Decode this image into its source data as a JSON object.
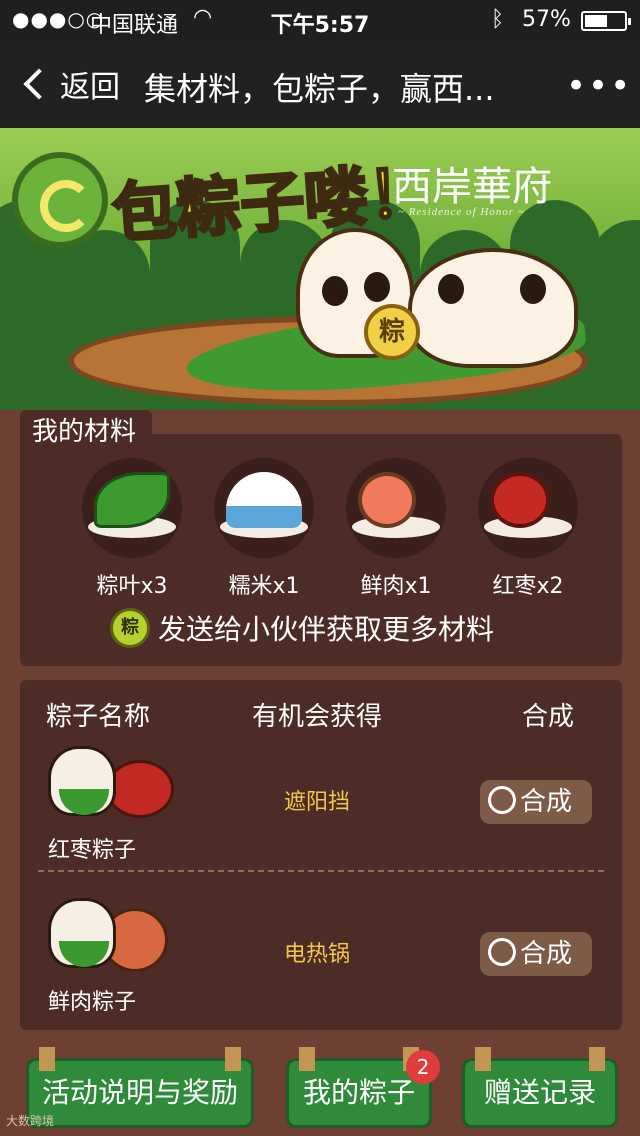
{
  "status_bar": {
    "signal": "●●●○○",
    "carrier": "中国联通",
    "time": "下午5:57",
    "battery_pct": "57%"
  },
  "nav": {
    "back_label": "返回",
    "title": "集材料，包粽子，赢西...",
    "more": "•••"
  },
  "banner": {
    "headline": "包粽子喽！",
    "brand": "西岸華府",
    "brand_sub": "~ Residence of Honor ~",
    "coin_text": "粽"
  },
  "materials": {
    "title": "我的材料",
    "items": [
      {
        "label": "粽叶x3",
        "icon": "leaf-icon"
      },
      {
        "label": "糯米x1",
        "icon": "rice-bowl-icon"
      },
      {
        "label": "鲜肉x1",
        "icon": "meat-icon"
      },
      {
        "label": "红枣x2",
        "icon": "red-date-icon"
      }
    ],
    "send_coin": "粽",
    "send_text": "发送给小伙伴获取更多材料"
  },
  "recipes": {
    "headers": {
      "name": "粽子名称",
      "prize": "有机会获得",
      "action": "合成"
    },
    "rows": [
      {
        "name": "红枣粽子",
        "prize": "遮阳挡",
        "action": "合成"
      },
      {
        "name": "鲜肉粽子",
        "prize": "电热锅",
        "action": "合成"
      }
    ]
  },
  "bottom_nav": {
    "rules": "活动说明与奖励",
    "my_zongzi": "我的粽子",
    "badge": "2",
    "gift_record": "赠送记录"
  },
  "watermark": "大数跨境"
}
